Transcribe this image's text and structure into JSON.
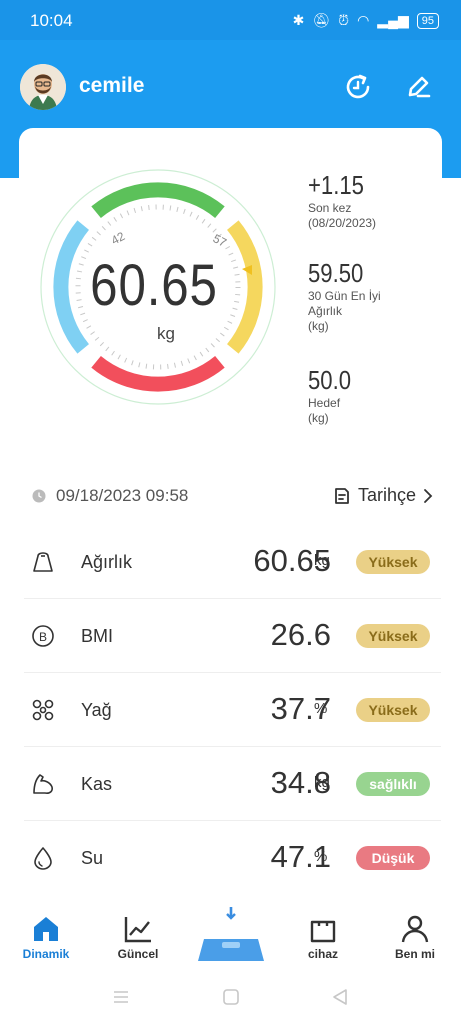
{
  "status_bar": {
    "time": "10:04",
    "battery": "95"
  },
  "header": {
    "username": "cemile"
  },
  "gauge": {
    "value": "60.65",
    "unit": "kg",
    "tick_low": "42",
    "tick_high": "57"
  },
  "stats": [
    {
      "value": "+1.15",
      "label_line1": "Son kez",
      "label_line2": "(08/20/2023)",
      "label_line3": ""
    },
    {
      "value": "59.50",
      "label_line1": "30 Gün En İyi",
      "label_line2": "Ağırlık",
      "label_line3": "(kg)"
    },
    {
      "value": "50.0",
      "label_line1": "Hedef",
      "label_line2": "(kg)",
      "label_line3": ""
    }
  ],
  "measurement": {
    "datetime": "09/18/2023 09:58",
    "history_label": "Tarihçe"
  },
  "metrics": [
    {
      "name": "Ağırlık",
      "value": "60.65",
      "unit": "kg",
      "status": "Yüksek",
      "status_color": "#ead087"
    },
    {
      "name": "BMI",
      "value": "26.6",
      "unit": "",
      "status": "Yüksek",
      "status_color": "#ead087"
    },
    {
      "name": "Yağ",
      "value": "37.7",
      "unit": "%",
      "status": "Yüksek",
      "status_color": "#ead087"
    },
    {
      "name": "Kas",
      "value": "34.8",
      "unit": "kg",
      "status": "sağlıklı",
      "status_color": "#98d490"
    },
    {
      "name": "Su",
      "value": "47.1",
      "unit": "%",
      "status": "Düşük",
      "status_color": "#e97a82"
    }
  ],
  "tabs": [
    {
      "label": "Dinamik",
      "active": true
    },
    {
      "label": "Güncel",
      "active": false
    },
    {
      "label": "",
      "active": false
    },
    {
      "label": "cihaz",
      "active": false
    },
    {
      "label": "Ben mi",
      "active": false
    }
  ],
  "colors": {
    "primary": "#1c9cf0",
    "gauge_green": "#5cc15a",
    "gauge_yellow": "#f5d75e",
    "gauge_red": "#f24f5c",
    "gauge_blue": "#7fd0f3"
  }
}
